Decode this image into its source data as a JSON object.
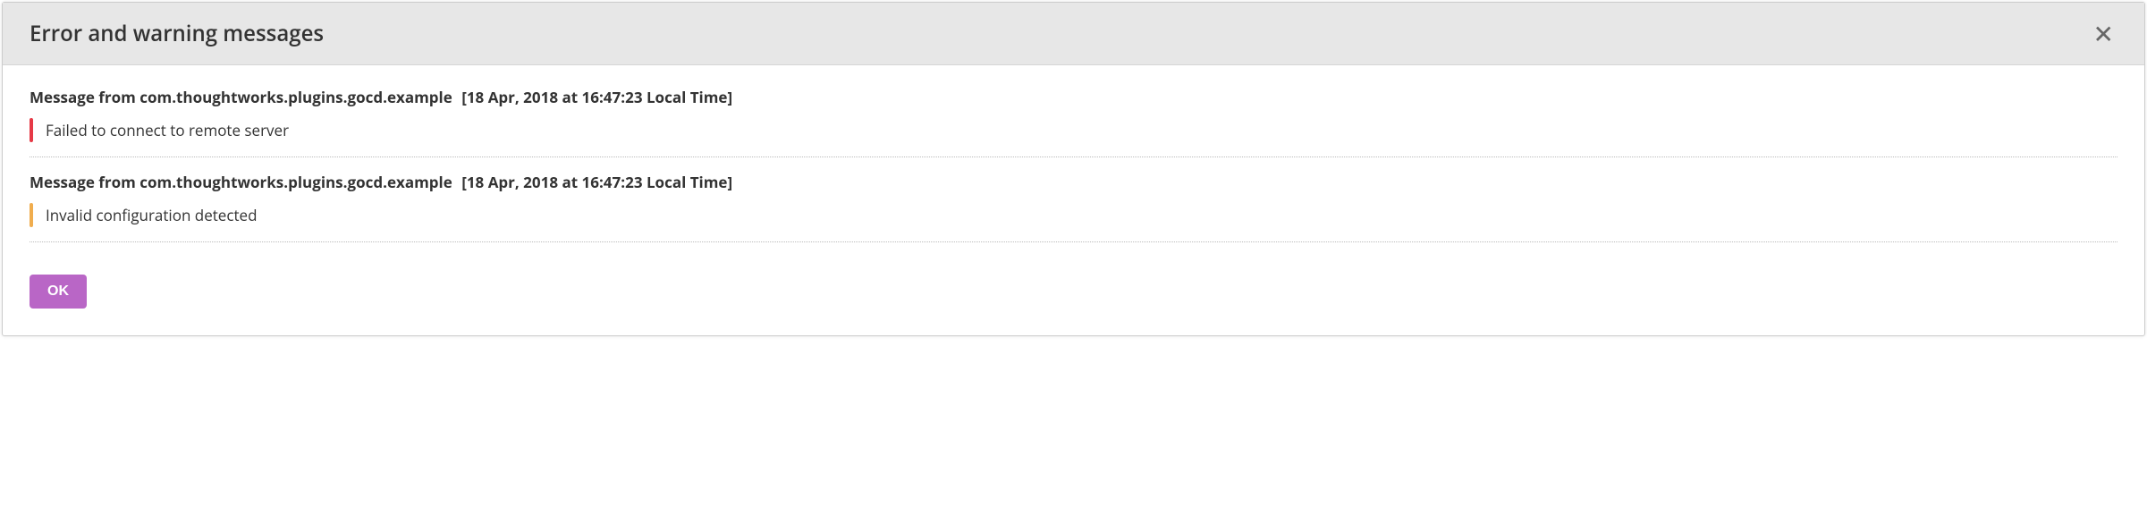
{
  "dialog": {
    "title": "Error and warning messages",
    "ok_label": "OK"
  },
  "messages": [
    {
      "prefix": "Message from",
      "source": "com.thoughtworks.plugins.gocd.example",
      "timestamp": "[18 Apr, 2018 at 16:47:23 Local Time]",
      "severity": "error",
      "text": "Failed to connect to remote server"
    },
    {
      "prefix": "Message from",
      "source": "com.thoughtworks.plugins.gocd.example",
      "timestamp": "[18 Apr, 2018 at 16:47:23 Local Time]",
      "severity": "warning",
      "text": "Invalid configuration detected"
    }
  ],
  "colors": {
    "error": "#e63946",
    "warning": "#f0ad4e",
    "button": "#b966c6",
    "header_bg": "#e7e7e7"
  }
}
